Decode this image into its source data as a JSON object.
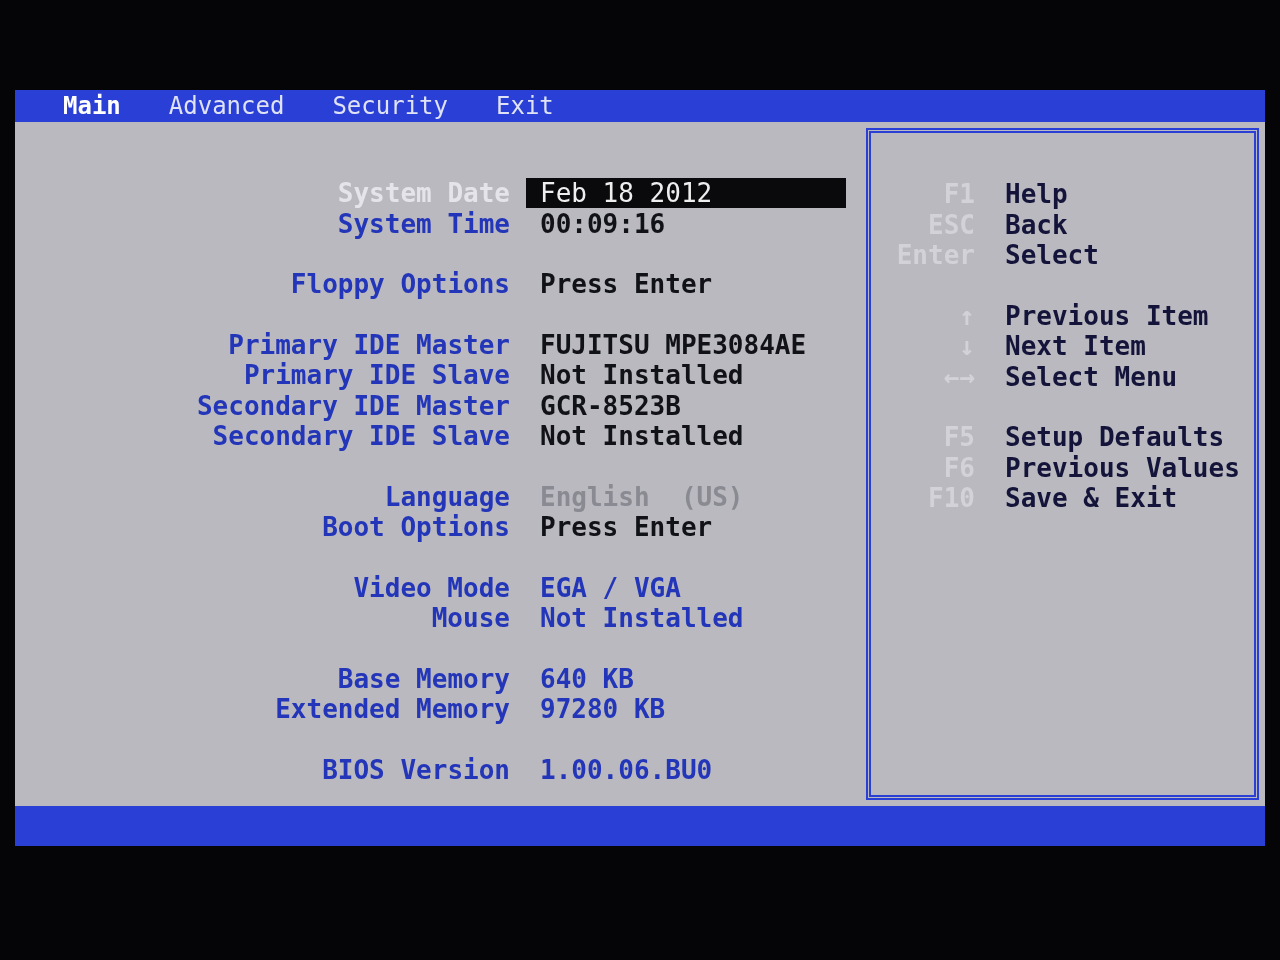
{
  "menu": [
    {
      "label": "Main",
      "selected": true
    },
    {
      "label": "Advanced",
      "selected": false
    },
    {
      "label": "Security",
      "selected": false
    },
    {
      "label": "Exit",
      "selected": false
    }
  ],
  "settings": [
    [
      {
        "label": "System Date",
        "value": "Feb 18 2012",
        "kind": "editable",
        "selected": true
      },
      {
        "label": "System Time",
        "value": "00:09:16",
        "kind": "editable",
        "selected": false
      }
    ],
    [
      {
        "label": "Floppy Options",
        "value": "Press Enter",
        "kind": "editable",
        "selected": false
      }
    ],
    [
      {
        "label": "Primary IDE Master",
        "value": "FUJITSU MPE3084AE",
        "kind": "editable",
        "selected": false
      },
      {
        "label": "Primary IDE Slave",
        "value": "Not Installed",
        "kind": "editable",
        "selected": false
      },
      {
        "label": "Secondary IDE Master",
        "value": "GCR-8523B",
        "kind": "editable",
        "selected": false
      },
      {
        "label": "Secondary IDE Slave",
        "value": "Not Installed",
        "kind": "editable",
        "selected": false
      }
    ],
    [
      {
        "label": "Language",
        "value": "English  (US)",
        "kind": "disabled",
        "selected": false
      },
      {
        "label": "Boot Options",
        "value": "Press Enter",
        "kind": "editable",
        "selected": false
      }
    ],
    [
      {
        "label": "Video Mode",
        "value": "EGA / VGA",
        "kind": "readonly",
        "selected": false
      },
      {
        "label": "Mouse",
        "value": "Not Installed",
        "kind": "readonly",
        "selected": false
      }
    ],
    [
      {
        "label": "Base Memory",
        "value": "640 KB",
        "kind": "readonly",
        "selected": false
      },
      {
        "label": "Extended Memory",
        "value": "97280 KB",
        "kind": "readonly",
        "selected": false
      }
    ],
    [
      {
        "label": "BIOS Version",
        "value": "1.00.06.BU0",
        "kind": "readonly",
        "selected": false
      }
    ]
  ],
  "help": [
    [
      {
        "key": "F1",
        "action": "Help"
      },
      {
        "key": "ESC",
        "action": "Back"
      },
      {
        "key": "Enter",
        "action": "Select"
      }
    ],
    [
      {
        "key": "↑",
        "action": "Previous Item"
      },
      {
        "key": "↓",
        "action": "Next Item"
      },
      {
        "key": "←→",
        "action": "Select Menu"
      }
    ],
    [
      {
        "key": "F5",
        "action": "Setup Defaults"
      },
      {
        "key": "F6",
        "action": "Previous Values"
      },
      {
        "key": "F10",
        "action": "Save & Exit"
      }
    ]
  ]
}
